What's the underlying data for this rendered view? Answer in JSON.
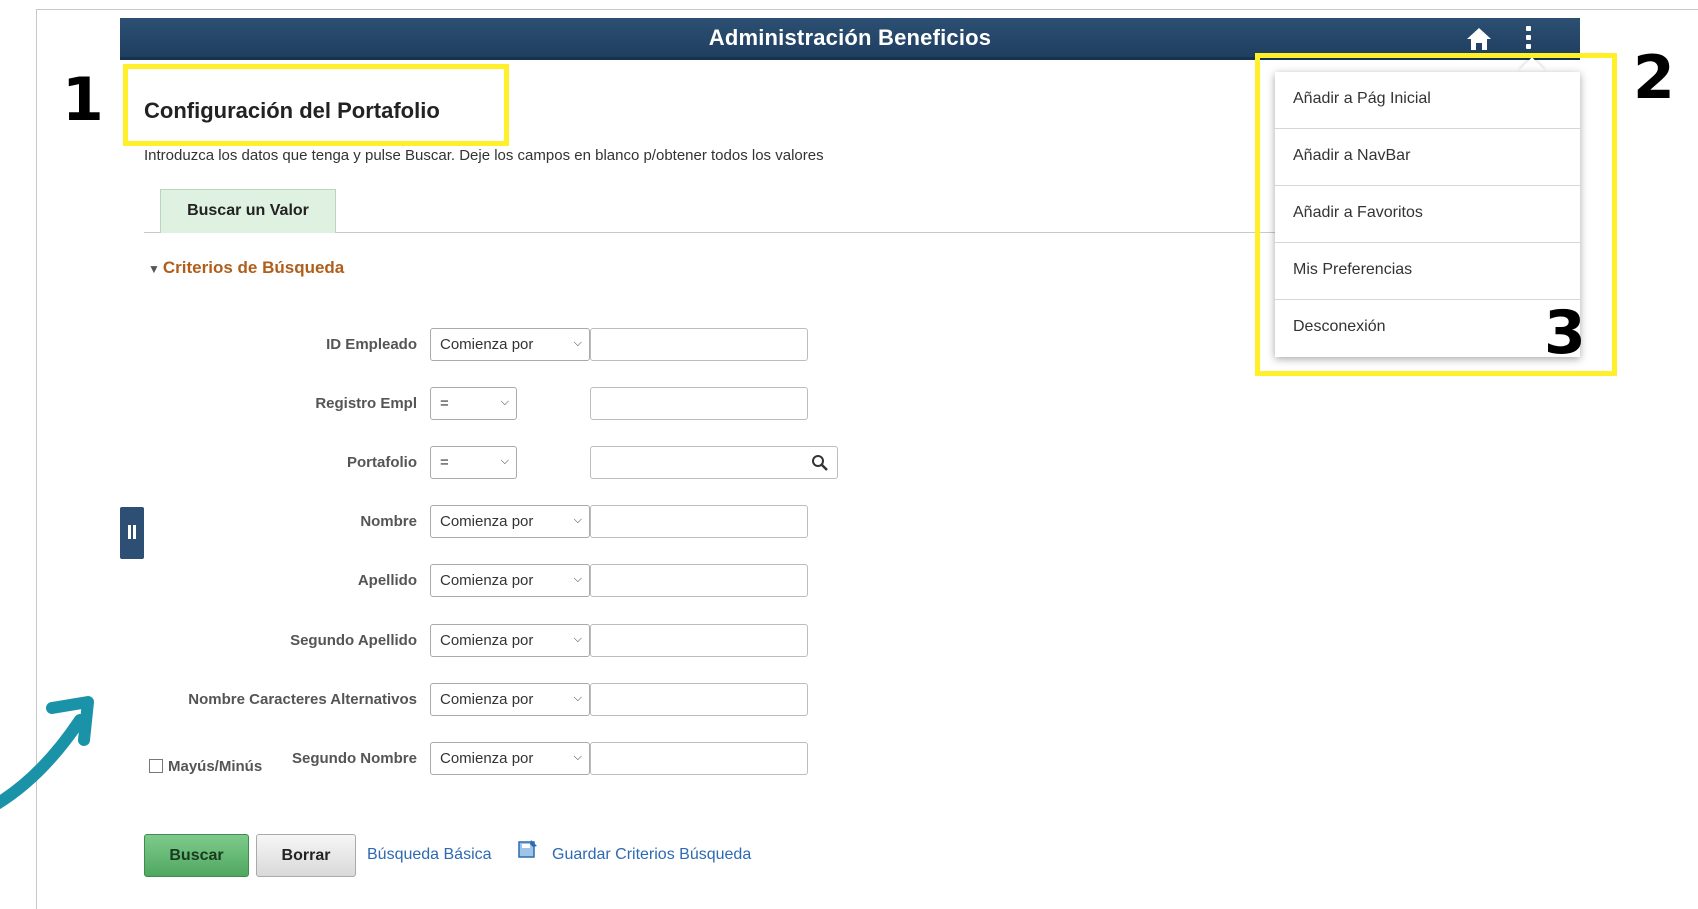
{
  "header": {
    "title": "Administración Beneficios"
  },
  "page": {
    "title": "Configuración del Portafolio",
    "intro": "Introduzca los datos que tenga y pulse Buscar. Deje los campos en blanco p/obtener todos los valores"
  },
  "tabs": [
    {
      "label": "Buscar un Valor"
    }
  ],
  "criteria": {
    "header": "Criterios de Búsqueda",
    "fields": [
      {
        "label": "ID Empleado",
        "operator": "Comienza por",
        "value": ""
      },
      {
        "label": "Registro Empl",
        "operator": "=",
        "value": ""
      },
      {
        "label": "Portafolio",
        "operator": "=",
        "value": ""
      },
      {
        "label": "Nombre",
        "operator": "Comienza por",
        "value": ""
      },
      {
        "label": "Apellido",
        "operator": "Comienza por",
        "value": ""
      },
      {
        "label": "Segundo Apellido",
        "operator": "Comienza por",
        "value": ""
      },
      {
        "label": "Nombre Caracteres Alternativos",
        "operator": "Comienza por",
        "value": ""
      },
      {
        "label": "Segundo Nombre",
        "operator": "Comienza por",
        "value": ""
      }
    ],
    "case_label": "Mayús/Minús",
    "case_checked": false
  },
  "actions": {
    "search": "Buscar",
    "clear": "Borrar",
    "basic_search": "Búsqueda Básica",
    "save_criteria": "Guardar Criterios Búsqueda"
  },
  "actions_menu": {
    "items": [
      "Añadir a Pág Inicial",
      "Añadir a NavBar",
      "Añadir a Favoritos",
      "Mis Preferencias",
      "Desconexión"
    ]
  },
  "annotations": {
    "n1": "1",
    "n2": "2",
    "n3": "3"
  },
  "colors": {
    "header": "#1f3f60",
    "accent_link": "#2d6ab3",
    "section_title": "#b05e1b",
    "highlight": "#fff02a",
    "arrow": "#1a93a8"
  },
  "icons": [
    "home-icon",
    "kebab-menu-icon",
    "lookup-icon",
    "save-criteria-icon",
    "chevron-down-icon"
  ]
}
